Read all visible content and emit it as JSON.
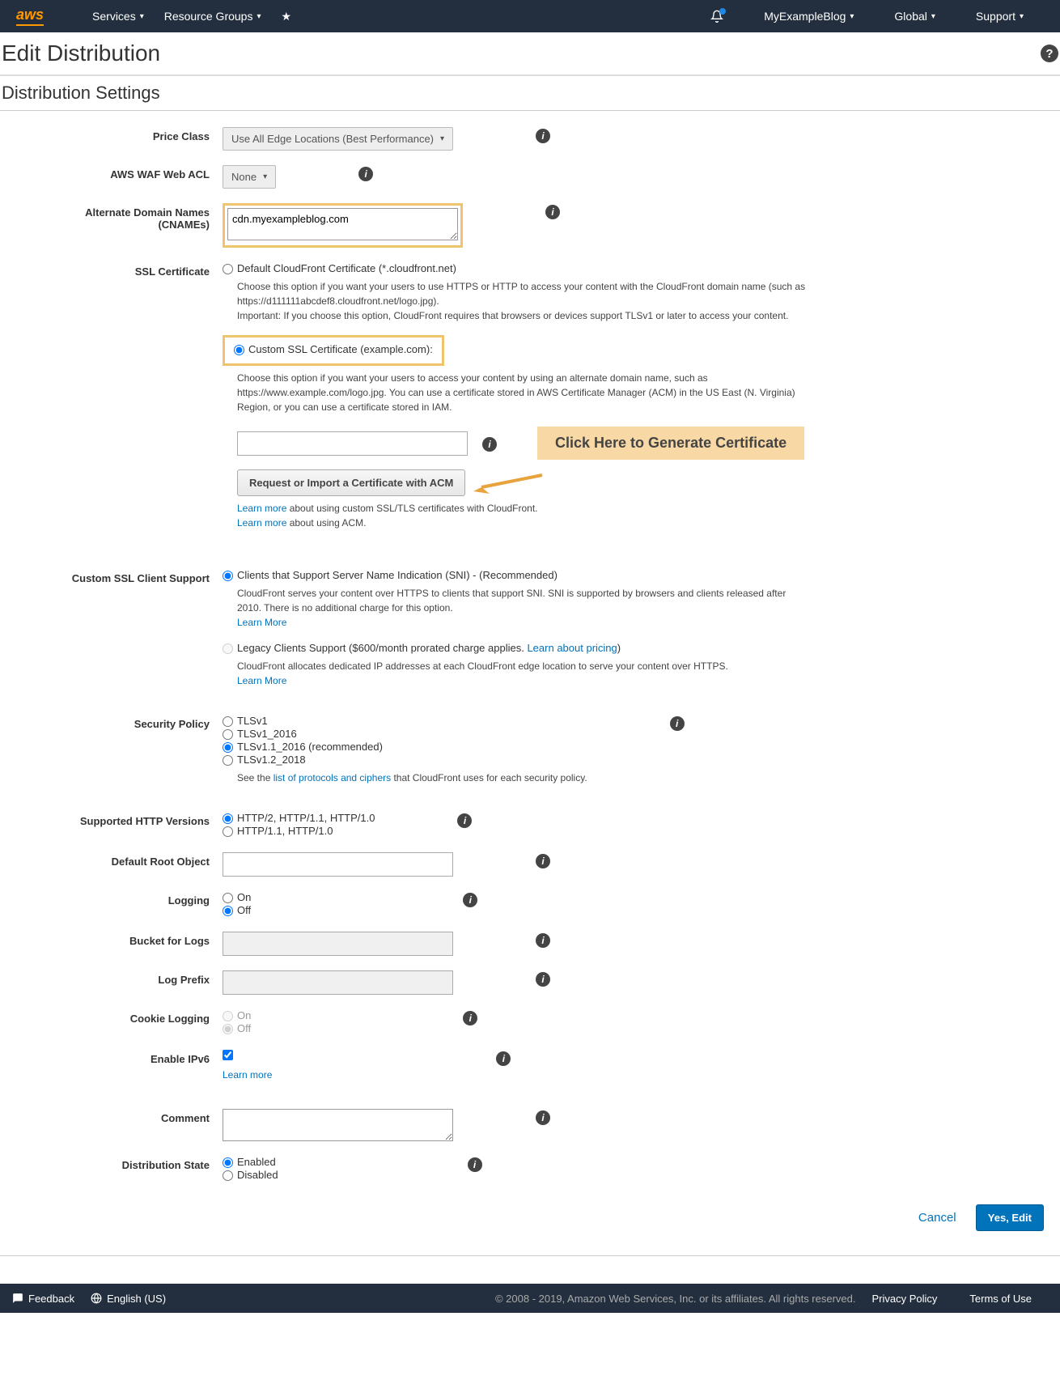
{
  "nav": {
    "services": "Services",
    "resourceGroups": "Resource Groups",
    "account": "MyExampleBlog",
    "region": "Global",
    "support": "Support"
  },
  "page": {
    "title": "Edit Distribution",
    "section": "Distribution Settings"
  },
  "priceClass": {
    "label": "Price Class",
    "value": "Use All Edge Locations (Best Performance)"
  },
  "waf": {
    "label": "AWS WAF Web ACL",
    "value": "None"
  },
  "cname": {
    "label1": "Alternate Domain Names",
    "label2": "(CNAMEs)",
    "value": "cdn.myexampleblog.com"
  },
  "ssl": {
    "label": "SSL Certificate",
    "opt1": "Default CloudFront Certificate (*.cloudfront.net)",
    "opt1help1": "Choose this option if you want your users to use HTTPS or HTTP to access your content with the CloudFront domain name (such as https://d111111abcdef8.cloudfront.net/logo.jpg).",
    "opt1help2": "Important: If you choose this option, CloudFront requires that browsers or devices support TLSv1 or later to access your content.",
    "opt2": "Custom SSL Certificate (example.com):",
    "opt2help": "Choose this option if you want your users to access your content by using an alternate domain name, such as https://www.example.com/logo.jpg. You can use a certificate stored in AWS Certificate Manager (ACM) in the US East (N. Virginia) Region, or you can use a certificate stored in IAM.",
    "acmButton": "Request or Import a Certificate with ACM",
    "learn1a": "Learn more",
    "learn1b": " about using custom SSL/TLS certificates with CloudFront.",
    "learn2a": "Learn more",
    "learn2b": " about using ACM.",
    "callout": "Click Here to Generate Certificate"
  },
  "clientSupport": {
    "label": "Custom SSL Client Support",
    "opt1": "Clients that Support Server Name Indication (SNI) - (Recommended)",
    "opt1help": "CloudFront serves your content over HTTPS to clients that support SNI. SNI is supported by browsers and clients released after 2010. There is no additional charge for this option.",
    "learnMore": "Learn More",
    "opt2a": "Legacy Clients Support ($600/month prorated charge applies. ",
    "opt2link": "Learn about pricing",
    "opt2b": ")",
    "opt2help": "CloudFront allocates dedicated IP addresses at each CloudFront edge location to serve your content over HTTPS."
  },
  "securityPolicy": {
    "label": "Security Policy",
    "o1": "TLSv1",
    "o2": "TLSv1_2016",
    "o3": "TLSv1.1_2016 (recommended)",
    "o4": "TLSv1.2_2018",
    "helpPre": "See the ",
    "helpLink": "list of protocols and ciphers",
    "helpPost": " that CloudFront uses for each security policy."
  },
  "httpVersions": {
    "label": "Supported HTTP Versions",
    "o1": "HTTP/2, HTTP/1.1, HTTP/1.0",
    "o2": "HTTP/1.1, HTTP/1.0"
  },
  "rootObject": {
    "label": "Default Root Object"
  },
  "logging": {
    "label": "Logging",
    "on": "On",
    "off": "Off"
  },
  "bucketLogs": {
    "label": "Bucket for Logs"
  },
  "logPrefix": {
    "label": "Log Prefix"
  },
  "cookieLogging": {
    "label": "Cookie Logging",
    "on": "On",
    "off": "Off"
  },
  "ipv6": {
    "label": "Enable IPv6",
    "learn": "Learn more"
  },
  "comment": {
    "label": "Comment"
  },
  "distState": {
    "label": "Distribution State",
    "enabled": "Enabled",
    "disabled": "Disabled"
  },
  "actions": {
    "cancel": "Cancel",
    "yesEdit": "Yes, Edit"
  },
  "footer": {
    "feedback": "Feedback",
    "language": "English (US)",
    "copyright": "© 2008 - 2019, Amazon Web Services, Inc. or its affiliates. All rights reserved.",
    "privacy": "Privacy Policy",
    "terms": "Terms of Use"
  }
}
